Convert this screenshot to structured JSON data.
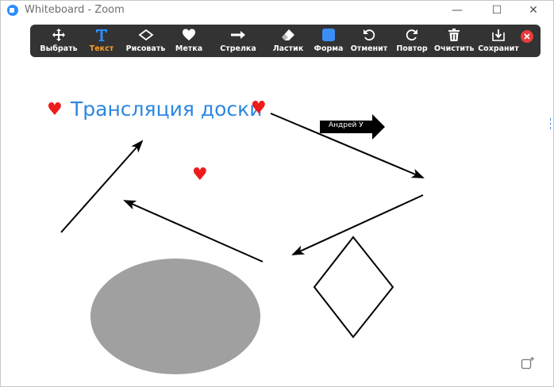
{
  "window": {
    "title": "Whiteboard - Zoom",
    "controls": {
      "minimize": "—",
      "maximize": "☐",
      "close": "✕"
    }
  },
  "toolbar": {
    "items": [
      {
        "id": "select",
        "label": "Выбрать",
        "icon": "move-icon"
      },
      {
        "id": "text",
        "label": "Текст",
        "icon": "text-icon",
        "active": true
      },
      {
        "id": "draw",
        "label": "Рисовать",
        "icon": "diamond-icon"
      },
      {
        "id": "stamp",
        "label": "Метка",
        "icon": "heart-icon"
      },
      {
        "id": "arrow",
        "label": "Стрелка",
        "icon": "arrow-right-icon"
      },
      {
        "id": "eraser",
        "label": "Ластик",
        "icon": "eraser-icon"
      },
      {
        "id": "shape",
        "label": "Форма",
        "icon": "square-icon"
      },
      {
        "id": "undo",
        "label": "Отменит",
        "icon": "undo-icon"
      },
      {
        "id": "redo",
        "label": "Повтор",
        "icon": "redo-icon"
      },
      {
        "id": "clear",
        "label": "Очистить",
        "icon": "trash-icon"
      },
      {
        "id": "save",
        "label": "Сохранит",
        "icon": "download-icon"
      }
    ],
    "close_icon": "close-icon"
  },
  "board": {
    "text": "Трансляция доски",
    "arrow_label": "Андрей У",
    "heart_glyph": "♥"
  },
  "colors": {
    "toolbar_bg": "#333333",
    "active_tool": "#f7a12a",
    "text_blue": "#2b87e0",
    "heart_red": "#ee1b1b",
    "shape_blue": "#3a8ef6",
    "ellipse_gray": "#a0a0a0"
  }
}
